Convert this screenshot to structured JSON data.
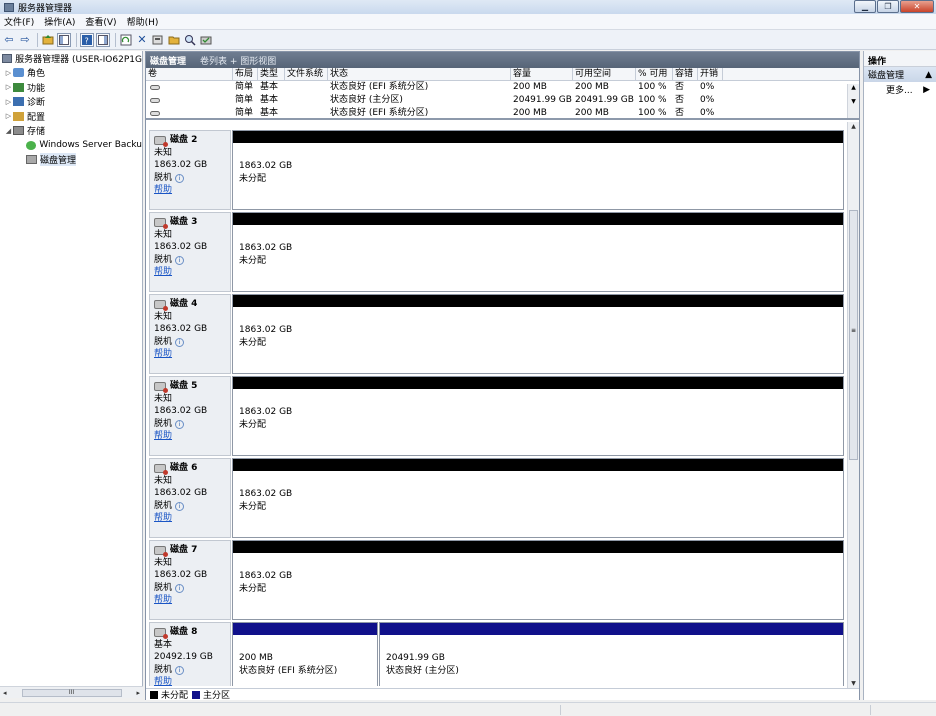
{
  "window": {
    "title": "服务器管理器",
    "minimize": "▁",
    "maximize": "❐",
    "close": "✕"
  },
  "menu": [
    {
      "label": "文件(F)"
    },
    {
      "label": "操作(A)"
    },
    {
      "label": "查看(V)"
    },
    {
      "label": "帮助(H)"
    }
  ],
  "toolbar": {
    "back": "⇦",
    "forward": "⇨",
    "delete": "✕"
  },
  "tree": {
    "items": [
      {
        "label": "服务器管理器 (USER-IO62P1G",
        "icon": "server-icon",
        "expander": ""
      },
      {
        "label": "角色",
        "icon": "roles-icon",
        "expander": "▷"
      },
      {
        "label": "功能",
        "icon": "features-icon",
        "expander": "▷"
      },
      {
        "label": "诊断",
        "icon": "diagnostics-icon",
        "expander": "▷"
      },
      {
        "label": "配置",
        "icon": "configuration-icon",
        "expander": "▷"
      },
      {
        "label": "存储",
        "icon": "storage-icon",
        "expander": "◢"
      },
      {
        "label": "Windows Server Backu",
        "icon": "backup-icon",
        "expander": ""
      },
      {
        "label": "磁盘管理",
        "icon": "disk-management-icon",
        "expander": ""
      }
    ],
    "hscroll_left": "◂",
    "hscroll_thumb": "III",
    "hscroll_right": "▸"
  },
  "center": {
    "title": "磁盘管理",
    "view": "卷列表 + 图形视图"
  },
  "volume_table": {
    "headers": [
      "卷",
      "布局",
      "类型",
      "文件系统",
      "状态",
      "容量",
      "可用空间",
      "% 可用",
      "容错",
      "开销"
    ],
    "rows": [
      [
        "",
        "简单",
        "基本",
        "",
        "状态良好 (EFI 系统分区)",
        "200 MB",
        "200 MB",
        "100 %",
        "否",
        "0%"
      ],
      [
        "",
        "简单",
        "基本",
        "",
        "状态良好 (主分区)",
        "20491.99 GB",
        "20491.99 GB",
        "100 %",
        "否",
        "0%"
      ],
      [
        "",
        "简单",
        "基本",
        "",
        "状态良好 (EFI 系统分区)",
        "200 MB",
        "200 MB",
        "100 %",
        "否",
        "0%"
      ]
    ]
  },
  "disks": [
    {
      "name": "磁盘 2",
      "type": "未知",
      "size": "1863.02 GB",
      "status": "脱机",
      "help": "帮助",
      "partitions": [
        {
          "size": "1863.02 GB",
          "status": "未分配",
          "kind": "unallocated"
        }
      ]
    },
    {
      "name": "磁盘 3",
      "type": "未知",
      "size": "1863.02 GB",
      "status": "脱机",
      "help": "帮助",
      "partitions": [
        {
          "size": "1863.02 GB",
          "status": "未分配",
          "kind": "unallocated"
        }
      ]
    },
    {
      "name": "磁盘 4",
      "type": "未知",
      "size": "1863.02 GB",
      "status": "脱机",
      "help": "帮助",
      "partitions": [
        {
          "size": "1863.02 GB",
          "status": "未分配",
          "kind": "unallocated"
        }
      ]
    },
    {
      "name": "磁盘 5",
      "type": "未知",
      "size": "1863.02 GB",
      "status": "脱机",
      "help": "帮助",
      "partitions": [
        {
          "size": "1863.02 GB",
          "status": "未分配",
          "kind": "unallocated"
        }
      ]
    },
    {
      "name": "磁盘 6",
      "type": "未知",
      "size": "1863.02 GB",
      "status": "脱机",
      "help": "帮助",
      "partitions": [
        {
          "size": "1863.02 GB",
          "status": "未分配",
          "kind": "unallocated"
        }
      ]
    },
    {
      "name": "磁盘 7",
      "type": "未知",
      "size": "1863.02 GB",
      "status": "脱机",
      "help": "帮助",
      "partitions": [
        {
          "size": "1863.02 GB",
          "status": "未分配",
          "kind": "unallocated"
        }
      ]
    },
    {
      "name": "磁盘 8",
      "type": "基本",
      "size": "20492.19 GB",
      "status": "脱机",
      "help": "帮助",
      "partitions": [
        {
          "size": "200 MB",
          "status": "状态良好 (EFI 系统分区)",
          "kind": "primary"
        },
        {
          "size": "20491.99 GB",
          "status": "状态良好 (主分区)",
          "kind": "primary"
        }
      ]
    }
  ],
  "legend": [
    {
      "label": "未分配",
      "color": "#000000"
    },
    {
      "label": "主分区",
      "color": "#10108a"
    }
  ],
  "actions": {
    "title": "操作",
    "section": "磁盘管理",
    "section_arrow": "▲",
    "more": "更多...",
    "more_arrow": "▶"
  },
  "colors": {
    "unallocated": "#000000",
    "primary": "#10108a"
  }
}
